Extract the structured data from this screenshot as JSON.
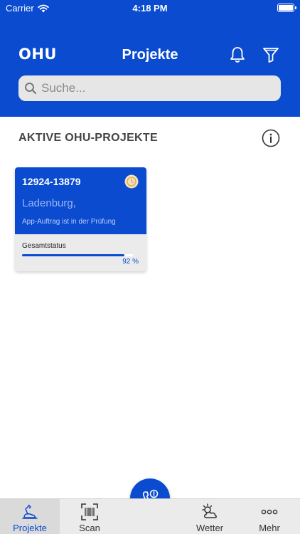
{
  "status_bar": {
    "carrier": "Carrier",
    "time": "4:18 PM"
  },
  "header": {
    "logo": "OHU",
    "title": "Projekte",
    "search_placeholder": "Suche..."
  },
  "section": {
    "title": "AKTIVE OHU-PROJEKTE"
  },
  "projects": [
    {
      "id": "12924-13879",
      "city": "Ladenburg,",
      "status": "App-Auftrag ist in der Prüfung",
      "overall_label": "Gesamtstatus",
      "progress_percent": 92,
      "progress_label": "92 %"
    }
  ],
  "tabbar": {
    "items": [
      {
        "label": "Projekte",
        "icon": "excavator-icon",
        "active": true
      },
      {
        "label": "Scan",
        "icon": "barcode-scan-icon",
        "active": false
      },
      {
        "label": "Wetter",
        "icon": "weather-cloud-sun-icon",
        "active": false
      },
      {
        "label": "Mehr",
        "icon": "more-dots-icon",
        "active": false
      }
    ],
    "fab_icon": "phone-alert-icon"
  },
  "colors": {
    "brand": "#0a4bd0",
    "tabbar_bg": "#ebebeb",
    "card_bg": "#ebebeb"
  }
}
